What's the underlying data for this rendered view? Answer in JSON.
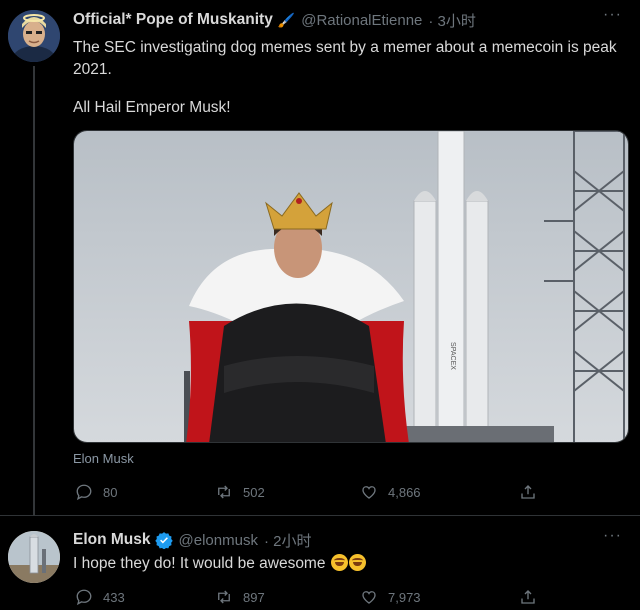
{
  "tweets": [
    {
      "author": {
        "name": "Official* Pope of Muskanity",
        "name_emoji": "🖌️",
        "handle": "@RationalEtienne",
        "time": "· 3小时"
      },
      "text_line1": "The SEC investigating dog memes sent by a memer about a memecoin is peak 2021.",
      "text_line2": "All Hail Emperor Musk!",
      "media_caption": "Elon Musk",
      "media_texts": [
        "SPACEX"
      ],
      "stats": {
        "replies": "80",
        "retweets": "502",
        "likes": "4,866"
      },
      "more_label": "···"
    },
    {
      "author": {
        "name": "Elon Musk",
        "verified": true,
        "handle": "@elonmusk",
        "time": "· 2小时"
      },
      "text": "I hope they do! It would be awesome",
      "text_emojis": [
        "rolling-on-floor-laughing",
        "rolling-on-floor-laughing"
      ],
      "stats": {
        "replies": "433",
        "retweets": "897",
        "likes": "7,973"
      },
      "more_label": "···"
    }
  ],
  "colors": {
    "background": "#000000",
    "text": "#d9d9d9",
    "muted": "#6e767d",
    "verified": "#1d9bf0",
    "divider": "#2f3336"
  },
  "icons": [
    "comment-icon",
    "retweet-icon",
    "like-icon",
    "share-icon",
    "verified-badge-icon",
    "more-icon"
  ]
}
